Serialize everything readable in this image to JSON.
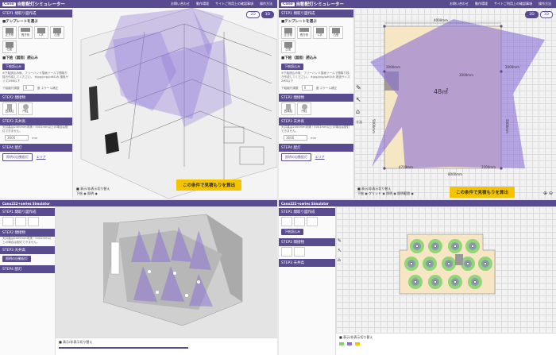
{
  "app": {
    "logo": "Cano",
    "title": "自動配灯シミュレーター",
    "title2": "Cano222+series Simulator"
  },
  "nav": [
    "お問い合わせ",
    "動作環境",
    "サイトご利用上の確認事項",
    "操作方法"
  ],
  "step1": "STEP1 間取り図作成",
  "template_heading": "■テンプレートを選ぶ",
  "templates": [
    "正方形",
    "長方形",
    "L字",
    "凸型",
    "凹型"
  ],
  "upload_heading": "■下絵（図面）読込み",
  "upload_btn": "下絵読込み",
  "upload_note": "※下絵読込み後、フリーハンド描画ツールで間取り描き作成してください。 ※jpg/png/pdfのみ 推奨サイズ2MB以下",
  "scale_label": "下絵縮尺調整",
  "scale_value": "0",
  "scale_unit": "度",
  "scale_fix": "スケール補正",
  "step2": "STEP2 間接物",
  "shapes": [
    "四角柱",
    "円柱"
  ],
  "step3": "STEP3 天井高",
  "ceiling_note": "天井高は2400mm未満・5001mm以上の場合は配灯できません。",
  "ceiling_value": "3600",
  "ceiling_unit": "mm",
  "step4": "STEP4 配灯",
  "auto_btn": "照明の自動配灯",
  "area_link": "エリア",
  "cta": "この条件で見積もりを算出",
  "view2d": "2D",
  "view3d": "3D",
  "show_hide": "■ 表示/非表示切り替え",
  "opt_floor": "下絵",
  "opt_light": "照明",
  "opt_grid": "グリッド",
  "opt_range": "照明範囲",
  "dims": {
    "top": "4000mm",
    "left1": "2000mm",
    "left2": "2000mm",
    "right": "2000mm",
    "side_l": "5000mm",
    "side_r": "5000mm",
    "area": "48㎡",
    "bot1": "4700mm",
    "bot2": "8000mm",
    "bot3": "3300mm"
  },
  "colors": {
    "brand": "#5a4a8f",
    "cta": "#f5c400",
    "room": "#f7e6c4",
    "light": "#8a6fd6"
  }
}
